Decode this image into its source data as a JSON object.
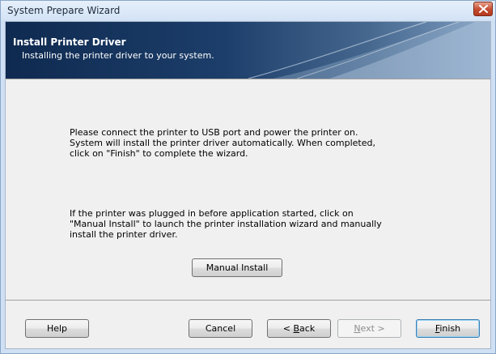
{
  "window": {
    "title": "System Prepare Wizard"
  },
  "banner": {
    "heading": "Install Printer Driver",
    "subheading": "Installing the printer driver to your system."
  },
  "content": {
    "paragraph1": [
      "Please connect the printer to USB port and power the printer on.",
      "System will install the printer driver automatically. When completed,",
      "click on \"Finish\" to complete the wizard."
    ],
    "paragraph2": [
      "If the printer was plugged in before application started, click on",
      "\"Manual Install\" to launch the printer installation wizard and manually",
      "install the printer driver."
    ],
    "manual_install_label": "Manual Install"
  },
  "footer": {
    "help_label": "Help",
    "cancel_label": "Cancel",
    "back_label": "< Back",
    "back_prefix": "< ",
    "back_mnemonic": "B",
    "back_rest": "ack",
    "next_label": "Next >",
    "next_mnemonic": "N",
    "next_rest": "ext >",
    "finish_label": "Finish",
    "finish_mnemonic": "F",
    "finish_rest": "inish",
    "next_enabled": false
  },
  "colors": {
    "banner_dark": "#0f2a50",
    "banner_light": "#7e9cc0",
    "close_button": "#c44a2f",
    "window_frame": "#cfe0f4"
  },
  "icons": {
    "close": "close-icon"
  }
}
